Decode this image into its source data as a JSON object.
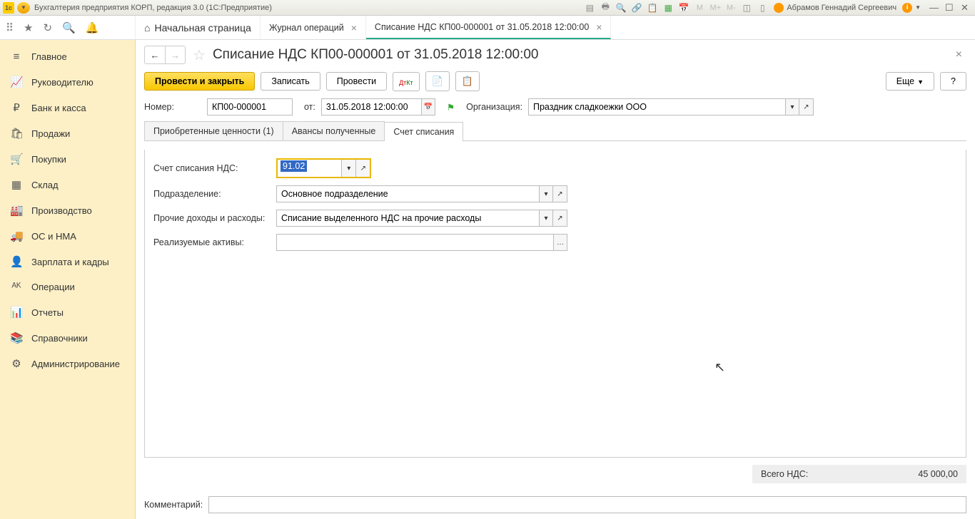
{
  "titlebar": {
    "app_title": "Бухгалтерия предприятия КОРП, редакция 3.0  (1С:Предприятие)",
    "user_name": "Абрамов Геннадий Сергеевич",
    "m_labels": [
      "M",
      "M+",
      "M-"
    ]
  },
  "tabs": {
    "home": "Начальная страница",
    "t1": "Журнал операций",
    "t2": "Списание НДС КП00-000001 от 31.05.2018 12:00:00"
  },
  "sidebar": [
    {
      "icon": "≡",
      "label": "Главное"
    },
    {
      "icon": "📈",
      "label": "Руководителю"
    },
    {
      "icon": "₽",
      "label": "Банк и касса"
    },
    {
      "icon": "🛍",
      "label": "Продажи"
    },
    {
      "icon": "🛒",
      "label": "Покупки"
    },
    {
      "icon": "▦",
      "label": "Склад"
    },
    {
      "icon": "🏭",
      "label": "Производство"
    },
    {
      "icon": "🚚",
      "label": "ОС и НМА"
    },
    {
      "icon": "👤",
      "label": "Зарплата и кадры"
    },
    {
      "icon": "ᴬᴷ",
      "label": "Операции"
    },
    {
      "icon": "📊",
      "label": "Отчеты"
    },
    {
      "icon": "📚",
      "label": "Справочники"
    },
    {
      "icon": "⚙",
      "label": "Администрирование"
    }
  ],
  "page": {
    "title": "Списание НДС КП00-000001 от 31.05.2018 12:00:00"
  },
  "actions": {
    "primary": "Провести и закрыть",
    "save": "Записать",
    "post": "Провести",
    "more": "Еще",
    "help": "?"
  },
  "form": {
    "number_label": "Номер:",
    "number_value": "КП00-000001",
    "date_label": "от:",
    "date_value": "31.05.2018 12:00:00",
    "org_label": "Организация:",
    "org_value": "Праздник сладкоежки ООО"
  },
  "inner_tabs": {
    "t1": "Приобретенные ценности (1)",
    "t2": "Авансы полученные",
    "t3": "Счет списания"
  },
  "fields": {
    "account_label": "Счет списания НДС:",
    "account_value": "91.02",
    "dept_label": "Подразделение:",
    "dept_value": "Основное подразделение",
    "other_label": "Прочие доходы и расходы:",
    "other_value": "Списание выделенного НДС на прочие расходы",
    "assets_label": "Реализуемые активы:",
    "assets_value": ""
  },
  "footer": {
    "total_label": "Всего НДС:",
    "total_value": "45 000,00",
    "comment_label": "Комментарий:",
    "comment_value": ""
  }
}
